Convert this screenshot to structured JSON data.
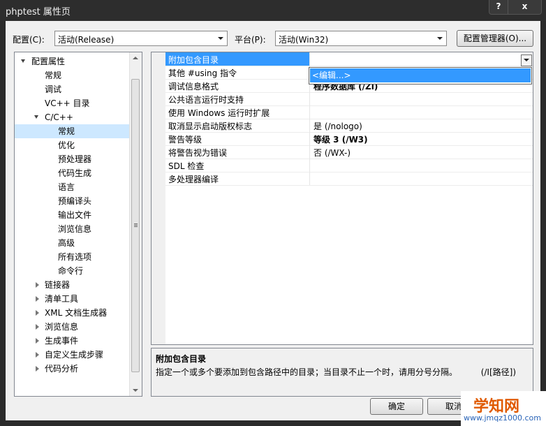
{
  "window": {
    "title": "phptest 属性页",
    "help_label": "?",
    "close_label": "x"
  },
  "toolbar": {
    "config_label": "配置(C):",
    "config_value": "活动(Release)",
    "platform_label": "平台(P):",
    "platform_value": "活动(Win32)",
    "config_manager_label": "配置管理器(O)..."
  },
  "tree": {
    "items": [
      {
        "label": "配置属性"
      },
      {
        "label": "常规"
      },
      {
        "label": "调试"
      },
      {
        "label": "VC++ 目录"
      },
      {
        "label": "C/C++"
      },
      {
        "label": "常规"
      },
      {
        "label": "优化"
      },
      {
        "label": "预处理器"
      },
      {
        "label": "代码生成"
      },
      {
        "label": "语言"
      },
      {
        "label": "预编译头"
      },
      {
        "label": "输出文件"
      },
      {
        "label": "浏览信息"
      },
      {
        "label": "高级"
      },
      {
        "label": "所有选项"
      },
      {
        "label": "命令行"
      },
      {
        "label": "链接器"
      },
      {
        "label": "清单工具"
      },
      {
        "label": "XML 文档生成器"
      },
      {
        "label": "浏览信息"
      },
      {
        "label": "生成事件"
      },
      {
        "label": "自定义生成步骤"
      },
      {
        "label": "代码分析"
      }
    ]
  },
  "grid": {
    "rows": [
      {
        "name": "附加包含目录",
        "value": ""
      },
      {
        "name": "其他 #using 指令",
        "value": ""
      },
      {
        "name": "调试信息格式",
        "value": "程序数据库 (/Zi)"
      },
      {
        "name": "公共语言运行时支持",
        "value": ""
      },
      {
        "name": "使用 Windows 运行时扩展",
        "value": ""
      },
      {
        "name": "取消显示启动版权标志",
        "value": "是 (/nologo)"
      },
      {
        "name": "警告等级",
        "value": "等级 3 (/W3)"
      },
      {
        "name": "将警告视为错误",
        "value": "否 (/WX-)"
      },
      {
        "name": "SDL 检查",
        "value": ""
      },
      {
        "name": "多处理器编译",
        "value": ""
      }
    ],
    "dropdown_item": "<编辑...>"
  },
  "description": {
    "title": "附加包含目录",
    "body": "指定一个或多个要添加到包含路径中的目录；当目录不止一个时，请用分号分隔。",
    "switch": "(/I[路径])"
  },
  "buttons": {
    "ok": "确定",
    "cancel": "取消"
  },
  "watermark": {
    "text": "学知网",
    "url": "www.jmqz1000.com"
  }
}
